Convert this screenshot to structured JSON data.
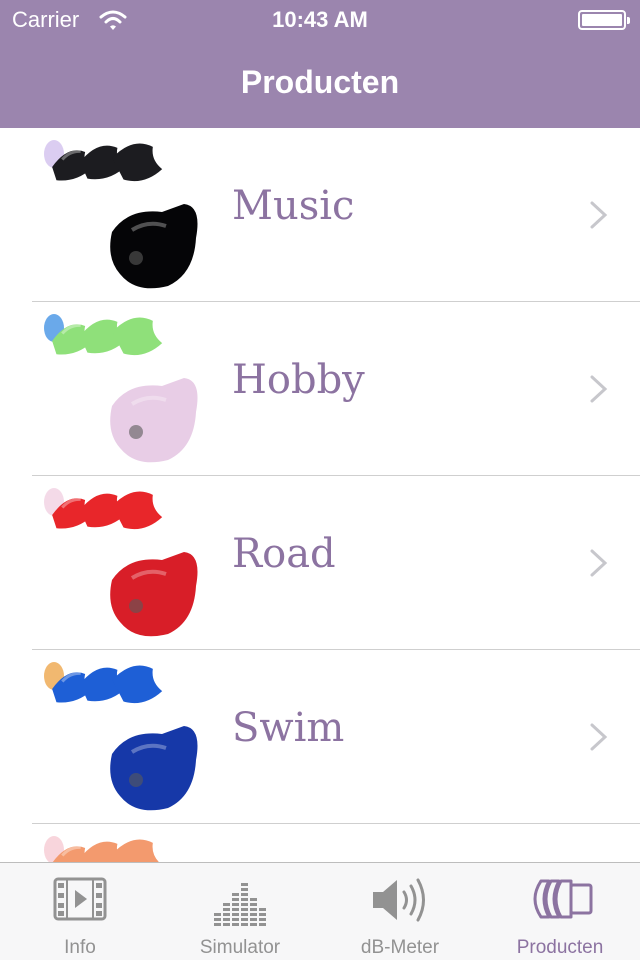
{
  "status_bar": {
    "carrier": "Carrier",
    "time": "10:43 AM",
    "battery_level": 1.0
  },
  "nav": {
    "title": "Producten"
  },
  "colors": {
    "accent": "#9b85ae",
    "label": "#8c73a1",
    "tab_inactive": "#929292"
  },
  "products": [
    {
      "label": "Music",
      "color": "#1c1c20",
      "color_dark": "#050507",
      "tip": "#d7c8f0"
    },
    {
      "label": "Hobby",
      "color": "#8fe07a",
      "color_dark": "#e8cde6",
      "tip": "#5aa0e8"
    },
    {
      "label": "Road",
      "color": "#e8262a",
      "color_dark": "#d81e28",
      "tip": "#f3d6e6"
    },
    {
      "label": "Swim",
      "color": "#1e5fd6",
      "color_dark": "#1638a8",
      "tip": "#f0b060"
    },
    {
      "label": "",
      "color": "#f39a6e",
      "color_dark": "#f39a6e",
      "tip": "#f7d0d8"
    }
  ],
  "tabbar": {
    "tabs": [
      {
        "label": "Info",
        "icon": "film-icon",
        "active": false
      },
      {
        "label": "Simulator",
        "icon": "equalizer-icon",
        "active": false
      },
      {
        "label": "dB-Meter",
        "icon": "speaker-icon",
        "active": false
      },
      {
        "label": "Producten",
        "icon": "earplug-icon",
        "active": true
      }
    ]
  }
}
